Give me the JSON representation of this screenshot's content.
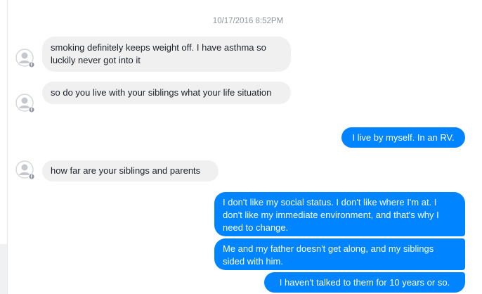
{
  "conversation": {
    "timestamp": "10/17/2016 8:52PM",
    "messages": [
      {
        "direction": "incoming",
        "text": "smoking definitely keeps weight off. I have asthma so luckily never got into it"
      },
      {
        "direction": "incoming",
        "text": "so do you live with your siblings what your life situation"
      },
      {
        "direction": "outgoing",
        "text": "I live by myself. In an RV."
      },
      {
        "direction": "incoming",
        "text": "how far are your siblings and parents"
      },
      {
        "direction": "outgoing",
        "text": "I don't like my social status. I don't like where I'm at. I don't like my immediate environment, and that's why I need to change."
      },
      {
        "direction": "outgoing",
        "text": "Me and my father doesn't get along, and my siblings sided with him."
      },
      {
        "direction": "outgoing",
        "text": "I haven't talked to them for 10 years or so."
      }
    ]
  },
  "colors": {
    "outgoing_bubble": "#0084ff",
    "incoming_bubble": "#f1f0f0",
    "timestamp_text": "#90949c"
  },
  "icons": {
    "avatar": "default-profile-avatar-icon",
    "badge": "messenger-badge-icon"
  }
}
